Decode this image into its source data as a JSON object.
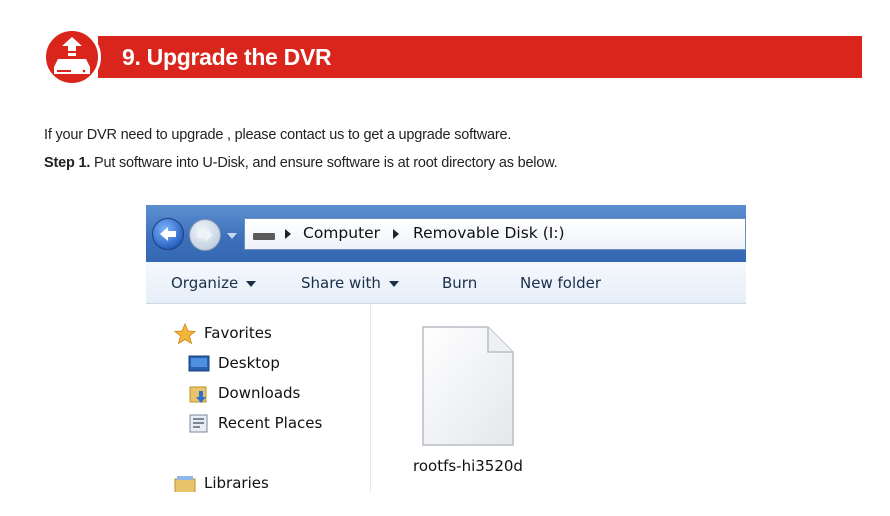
{
  "header": {
    "title": "9. Upgrade the DVR",
    "icon": "upgrade-dvr-icon",
    "accent_color": "#d9251c"
  },
  "body": {
    "intro": "If your DVR need to upgrade , please contact us to get a upgrade software.",
    "step1_label": "Step 1.",
    "step1_text": " Put software into U-Disk, and ensure software is at root directory as below."
  },
  "explorer": {
    "breadcrumb": [
      "Computer",
      "Removable Disk (I:)"
    ],
    "toolbar": {
      "organize": "Organize",
      "share_with": "Share with",
      "burn": "Burn",
      "new_folder": "New folder"
    },
    "nav": {
      "favorites": "Favorites",
      "desktop": "Desktop",
      "downloads": "Downloads",
      "recent_places": "Recent Places",
      "libraries": "Libraries"
    },
    "file": {
      "name": "rootfs-hi3520d",
      "icon": "blank-file-icon"
    }
  }
}
